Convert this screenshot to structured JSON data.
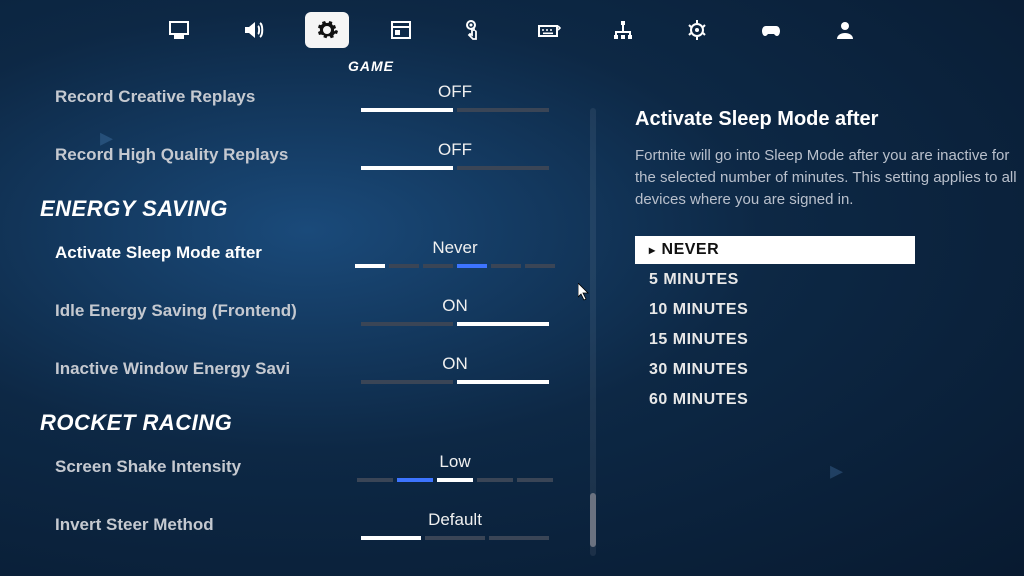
{
  "nav": {
    "subtab_label": "GAME"
  },
  "settings": [
    {
      "label": "Record Creative Replays",
      "value": "OFF",
      "ticks": [
        "on",
        "off"
      ],
      "tick_w": 92
    },
    {
      "label": "Record High Quality Replays",
      "value": "OFF",
      "ticks": [
        "on",
        "off"
      ],
      "tick_w": 92
    }
  ],
  "section1": {
    "title": "ENERGY SAVING"
  },
  "settings_energy": [
    {
      "label": "Activate Sleep Mode after",
      "value": "Never",
      "ticks": [
        "on",
        "off",
        "off",
        "hl",
        "off",
        "off"
      ],
      "tick_w": 30,
      "selected": true
    },
    {
      "label": "Idle Energy Saving (Frontend)",
      "value": "ON",
      "ticks": [
        "off",
        "on"
      ],
      "tick_w": 92
    },
    {
      "label": "Inactive Window Energy Savi",
      "value": "ON",
      "ticks": [
        "off",
        "on"
      ],
      "tick_w": 92
    }
  ],
  "section2": {
    "title": "ROCKET RACING"
  },
  "settings_rocket": [
    {
      "label": "Screen Shake Intensity",
      "value": "Low",
      "ticks": [
        "off",
        "hl",
        "on",
        "off",
        "off"
      ],
      "tick_w": 36
    },
    {
      "label": "Invert Steer Method",
      "value": "Default",
      "ticks": [
        "on",
        "off",
        "off"
      ],
      "tick_w": 60
    }
  ],
  "detail": {
    "title": "Activate Sleep Mode after",
    "desc": "Fortnite will go into Sleep Mode after you are inactive for the selected number of minutes. This setting applies to all devices where you are signed in.",
    "options": [
      "NEVER",
      "5 MINUTES",
      "10 MINUTES",
      "15 MINUTES",
      "30 MINUTES",
      "60 MINUTES"
    ],
    "selected_index": 0
  },
  "scroll": {
    "thumb_top_pct": 86,
    "thumb_h_pct": 12
  }
}
